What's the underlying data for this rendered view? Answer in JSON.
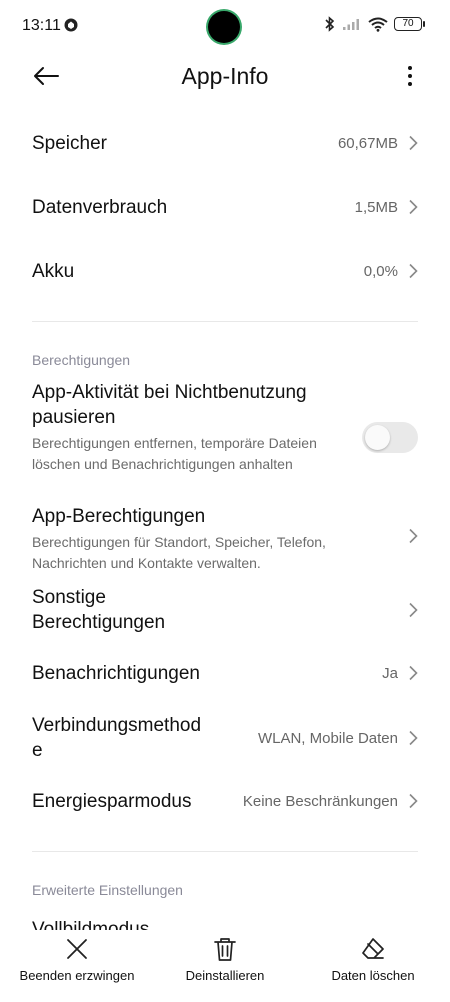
{
  "status_bar": {
    "time": "13:11",
    "battery": "70"
  },
  "header": {
    "title": "App-Info"
  },
  "storage_rows": [
    {
      "label": "Speicher",
      "value": "60,67MB"
    },
    {
      "label": "Datenverbrauch",
      "value": "1,5MB"
    },
    {
      "label": "Akku",
      "value": "0,0%"
    }
  ],
  "permissions": {
    "section_title": "Berechtigungen",
    "pause_app": {
      "title": "App-Aktivität bei Nichtbenutzung pausieren",
      "subtitle": "Berechtigungen entfernen, temporäre Dateien löschen und Benachrichtigungen anhalten",
      "enabled": false
    },
    "app_permissions": {
      "title": "App-Berechtigungen",
      "subtitle": "Berechtigungen für Standort, Speicher, Telefon, Nachrichten und Kontakte verwalten."
    },
    "other_permissions": {
      "title": "Sonstige Berechtigungen"
    },
    "notifications": {
      "label": "Benachrichtigungen",
      "value": "Ja"
    },
    "connection": {
      "label_line1": "Verbindungsmethod",
      "label_line2": "e",
      "value": "WLAN, Mobile Daten"
    },
    "battery_saver": {
      "label": "Energiesparmodus",
      "value": "Keine Beschränkungen"
    }
  },
  "advanced": {
    "section_title": "Erweiterte Einstellungen",
    "fullscreen_label": "Vollbildmodus"
  },
  "bottom_bar": {
    "force_stop": "Beenden erzwingen",
    "uninstall": "Deinstallieren",
    "clear_data": "Daten löschen"
  }
}
